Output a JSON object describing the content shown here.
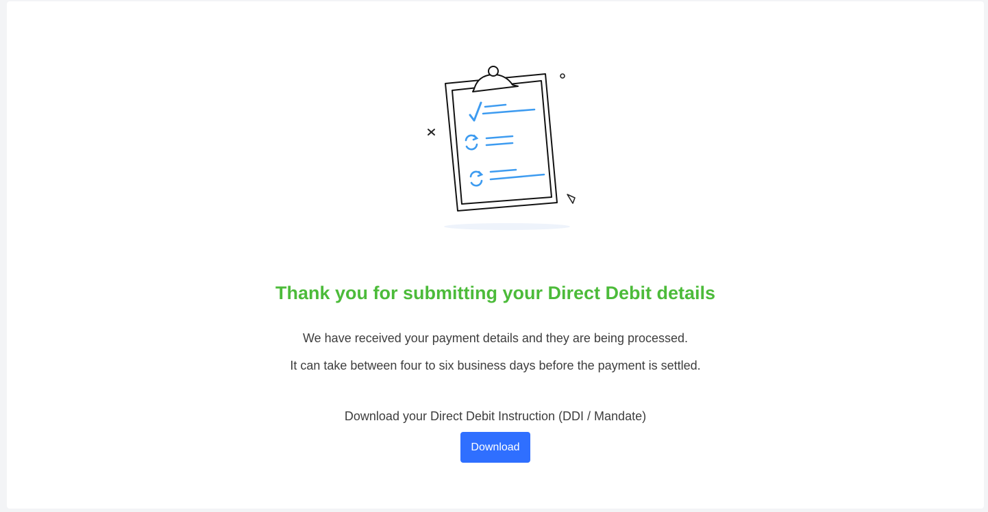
{
  "confirmation": {
    "title": "Thank you for submitting your Direct Debit details",
    "line1": "We have received your payment details and they are being processed.",
    "line2": "It can take between four to six business days before the payment is settled.",
    "download_prompt": "Download your Direct Debit Instruction (DDI / Mandate)",
    "download_label": "Download"
  },
  "colors": {
    "title_green": "#4cbb3a",
    "button_blue": "#2f6fff",
    "illustration_blue": "#3d9bf0"
  },
  "icons": {
    "illustration": "clipboard-checklist-illustration"
  }
}
